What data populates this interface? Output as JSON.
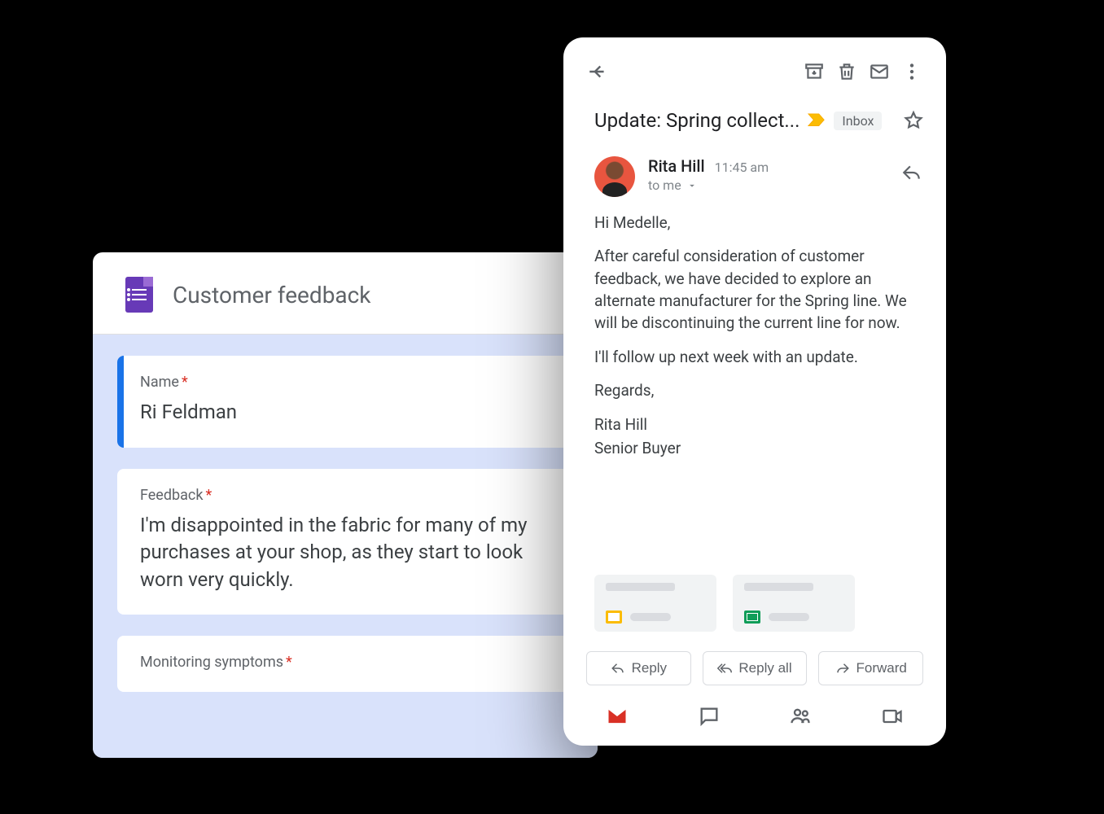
{
  "form": {
    "title": "Customer feedback",
    "questions": [
      {
        "label": "Name",
        "required": true,
        "answer": "Ri Feldman"
      },
      {
        "label": "Feedback",
        "required": true,
        "answer": "I'm disappointed in the fabric for many of my purchases at your shop, as they start to look worn very quickly."
      },
      {
        "label": "Monitoring symptoms",
        "required": true,
        "answer": ""
      }
    ]
  },
  "email": {
    "subject": "Update: Spring collect...",
    "label": "Inbox",
    "sender": {
      "name": "Rita Hill",
      "time": "11:45 am",
      "to": "to me"
    },
    "body": {
      "greeting": "Hi Medelle,",
      "para1": "After careful consideration of customer feedback, we have decided to explore an alternate manufacturer for the Spring line. We will be discontinuing the current line for now.",
      "para2": "I'll follow up next week with an update.",
      "closing": "Regards,",
      "sig1": "Rita Hill",
      "sig2": "Senior Buyer"
    },
    "actions": {
      "reply": "Reply",
      "replyAll": "Reply all",
      "forward": "Forward"
    }
  }
}
